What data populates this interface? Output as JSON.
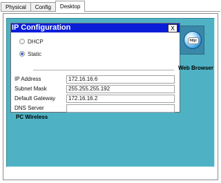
{
  "tabs": [
    {
      "label": "Physical",
      "active": false
    },
    {
      "label": "Config",
      "active": false
    },
    {
      "label": "Desktop",
      "active": true
    }
  ],
  "ip_config": {
    "title": "IP Configuration",
    "close_label": "X",
    "modes": [
      {
        "label": "DHCP",
        "selected": false
      },
      {
        "label": "Static",
        "selected": true
      }
    ],
    "fields": [
      {
        "label": "IP Address",
        "value": "172.16.16.6"
      },
      {
        "label": "Subnet Mask",
        "value": "255.255.255.192"
      },
      {
        "label": "Default Gateway",
        "value": "172.16.16.2"
      },
      {
        "label": "DNS Server",
        "value": ""
      }
    ]
  },
  "desktop": {
    "web_browser_label": "Web Browser",
    "web_browser_icon_text": "http:",
    "pc_wireless_label": "PC Wireless"
  },
  "colors": {
    "desktop_bg": "#4fb2c4",
    "title_bar": "#0a1ed8"
  }
}
